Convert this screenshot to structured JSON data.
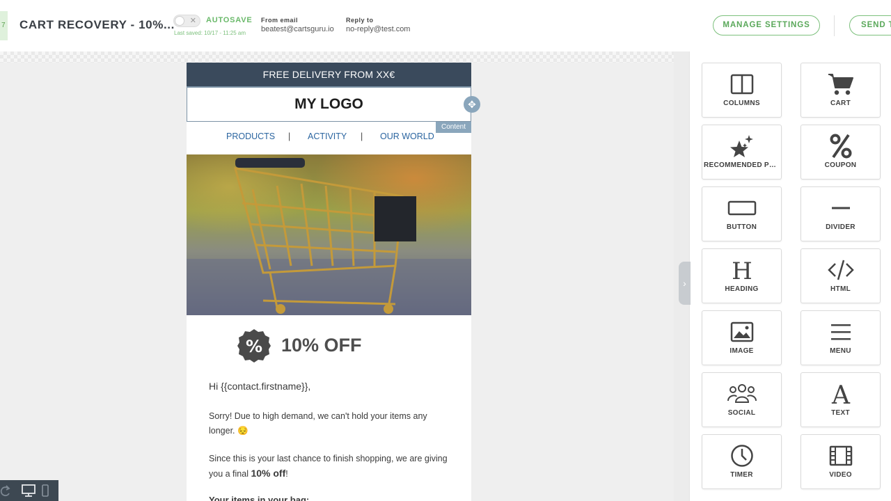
{
  "header": {
    "edge_tab": "7",
    "title": "CART RECOVERY - 10%...",
    "autosave_label": "AUTOSAVE",
    "last_saved": "Last saved: 10/17 - 11:25 am",
    "from_label": "From email",
    "from_value": "beatest@cartsguru.io",
    "reply_label": "Reply to",
    "reply_value": "no-reply@test.com",
    "manage_button": "MANAGE SETTINGS",
    "send_button": "SEND T",
    "autosave_enabled": false
  },
  "email": {
    "banner": "FREE DELIVERY FROM XX€",
    "logo": "MY LOGO",
    "content_tag": "Content",
    "nav": [
      "PRODUCTS",
      "|",
      "ACTIVITY",
      "|",
      "OUR WORLD"
    ],
    "offer": "10% OFF",
    "greeting": "Hi {{contact.firstname}},",
    "paragraph1": "Sorry! Due to high demand, we can't hold your items any longer. 😔",
    "paragraph2_start": "Since this is your last chance to finish shopping, we are giving you a final ",
    "paragraph2_bold": "10% off",
    "paragraph2_end": "!",
    "paragraph3": "Your items in your bag:"
  },
  "blocks": [
    {
      "label": "COLUMNS",
      "icon": "columns-icon"
    },
    {
      "label": "CART",
      "icon": "cart-icon"
    },
    {
      "label": "RECOMMENDED PR...",
      "icon": "sparkle-star-icon"
    },
    {
      "label": "COUPON",
      "icon": "percent-icon"
    },
    {
      "label": "BUTTON",
      "icon": "button-icon"
    },
    {
      "label": "DIVIDER",
      "icon": "divider-icon"
    },
    {
      "label": "HEADING",
      "icon": "heading-icon"
    },
    {
      "label": "HTML",
      "icon": "code-icon"
    },
    {
      "label": "IMAGE",
      "icon": "image-icon"
    },
    {
      "label": "MENU",
      "icon": "menu-icon"
    },
    {
      "label": "SOCIAL",
      "icon": "social-icon"
    },
    {
      "label": "TEXT",
      "icon": "text-icon"
    },
    {
      "label": "TIMER",
      "icon": "timer-icon"
    },
    {
      "label": "VIDEO",
      "icon": "video-icon"
    }
  ],
  "colors": {
    "accent_green": "#6ab96a",
    "banner_dark": "#3a4a5c",
    "selection_blue": "#8aa6bc",
    "nav_link": "#2b65a0"
  }
}
